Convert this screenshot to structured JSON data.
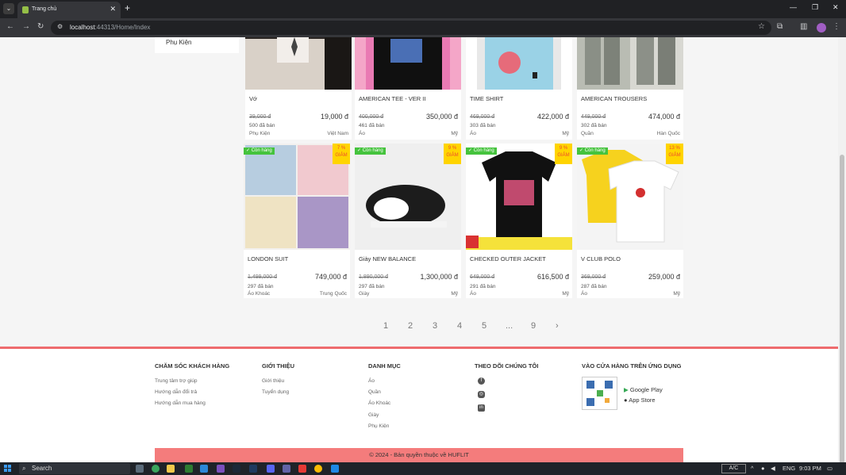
{
  "browser": {
    "tab_title": "Trang chủ",
    "url_host": "localhost",
    "url_rest": ":44313/Home/Index"
  },
  "sidebar": {
    "items": [
      {
        "label": "Phụ Kiện"
      }
    ]
  },
  "products_row1": [
    {
      "name": "Vớ",
      "old_price": "39,000 đ",
      "price": "19,000 đ",
      "sold": "500 đã bán",
      "category": "Phụ Kiện",
      "origin": "Việt Nam"
    },
    {
      "name": "AMERICAN TEE - VER II",
      "old_price": "400,000 đ",
      "price": "350,000 đ",
      "sold": "461 đã bán",
      "category": "Áo",
      "origin": "Mỹ"
    },
    {
      "name": "TIME SHIRT",
      "old_price": "469,000 đ",
      "price": "422,000 đ",
      "sold": "303 đã bán",
      "category": "Áo",
      "origin": "Mỹ"
    },
    {
      "name": "AMERICAN TROUSERS",
      "old_price": "449,000 đ",
      "price": "474,000 đ",
      "sold": "302 đã bán",
      "category": "Quần",
      "origin": "Hàn Quốc"
    }
  ],
  "products_row2": [
    {
      "name": "LONDON SUIT",
      "old_price": "1,499,000 đ",
      "price": "749,000 đ",
      "sold": "297 đã bán",
      "category": "Áo Khoác",
      "origin": "Trung Quốc",
      "stock": "✓ Còn hàng",
      "discount_pct": "7 %",
      "discount_word": "GIẢM"
    },
    {
      "name": "Giày NEW BALANCE",
      "old_price": "1,890,000 đ",
      "price": "1,300,000 đ",
      "sold": "297 đã bán",
      "category": "Giày",
      "origin": "Mỹ",
      "stock": "✓ Còn hàng",
      "discount_pct": "9 %",
      "discount_word": "GIẢM"
    },
    {
      "name": "CHECKED OUTER JACKET",
      "old_price": "649,000 đ",
      "price": "616,500 đ",
      "sold": "291 đã bán",
      "category": "Áo",
      "origin": "Mỹ",
      "stock": "✓ Còn hàng",
      "discount_pct": "9 %",
      "discount_word": "GIẢM"
    },
    {
      "name": "V CLUB POLO",
      "old_price": "369,000 đ",
      "price": "259,000 đ",
      "sold": "287 đã bán",
      "category": "Áo",
      "origin": "Mỹ",
      "stock": "✓ Còn hàng",
      "discount_pct": "13 %",
      "discount_word": "GIẢM"
    }
  ],
  "pagination": {
    "pages": [
      "1",
      "2",
      "3",
      "4",
      "5",
      "...",
      "9"
    ],
    "next": "›"
  },
  "footer": {
    "care": {
      "heading": "CHĂM SÓC KHÁCH HÀNG",
      "links": [
        "Trung tâm trợ giúp",
        "Hướng dẫn đổi trả",
        "Hướng dẫn mua hàng"
      ]
    },
    "about": {
      "heading": "GIỚI THIỆU",
      "links": [
        "Giới thiệu",
        "Tuyển dụng"
      ]
    },
    "categories": {
      "heading": "DANH MỤC",
      "links": [
        "Áo",
        "Quần",
        "Áo Khoác",
        "Giày",
        "Phụ Kiện"
      ]
    },
    "follow": {
      "heading": "THEO DÕI CHÚNG TÔI"
    },
    "app": {
      "heading": "VÀO CỬA HÀNG TRÊN ỨNG DỤNG",
      "google_play": "Google Play",
      "app_store": "App Store"
    },
    "copyright": "© 2024 - Bản quyền thuộc về HUFLIT"
  },
  "taskbar": {
    "search": "Search",
    "ac": "A/C",
    "lang": "ENG",
    "time": "9:03 PM"
  }
}
